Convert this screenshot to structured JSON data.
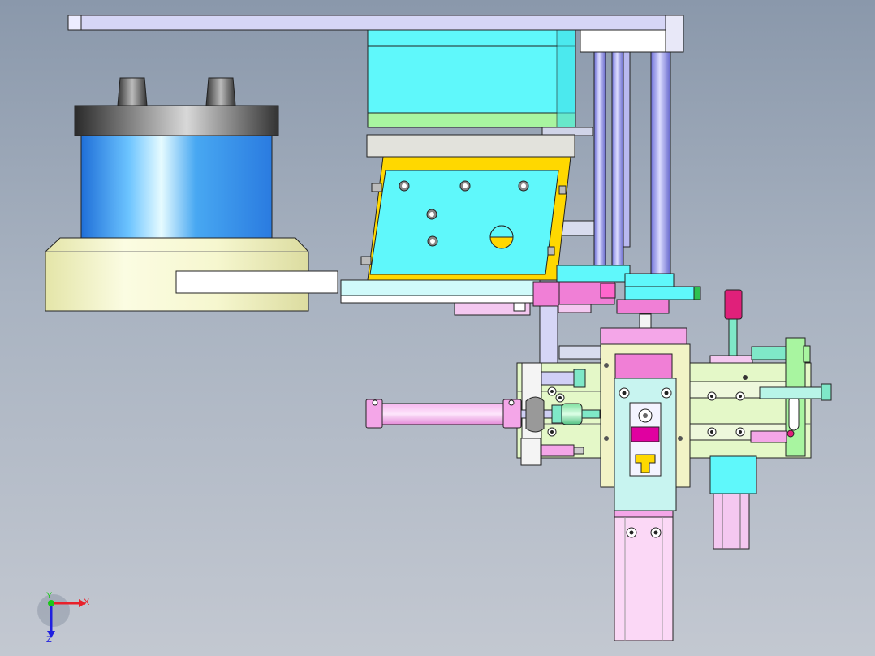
{
  "viewport": {
    "background_top": "#8a98ab",
    "background_bottom": "#c3c8d1"
  },
  "colors": {
    "cyan": "#5ff8fb",
    "light_green": "#a8f5a0",
    "pale_yellow": "#f2f3c6",
    "pink": "#f07fd6",
    "magenta": "#e000a0",
    "blue_cylinder": "#3ea0f0",
    "lavender": "#c6c4f5",
    "mint": "#7fe8c8",
    "yellow": "#ffd800",
    "light_grey": "#e6e6e6",
    "steel_blue": "#8c8ee8"
  },
  "triad": {
    "x_label": "X",
    "y_label": "Y",
    "z_label": "Z",
    "x_color": "#e8202a",
    "y_color": "#18c818",
    "z_color": "#2020e0"
  }
}
